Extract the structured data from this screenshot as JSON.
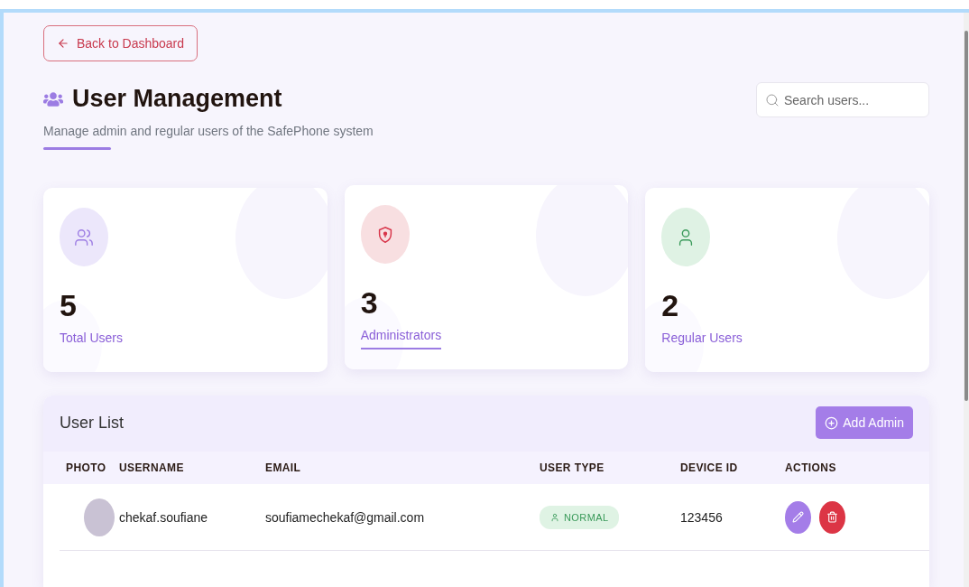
{
  "back_button": {
    "label": "Back to Dashboard"
  },
  "header": {
    "title": "User Management",
    "subtitle": "Manage admin and regular users of the SafePhone system"
  },
  "search": {
    "placeholder": "Search users..."
  },
  "stats": [
    {
      "kind": "total",
      "value": "5",
      "label": "Total Users",
      "selected": false
    },
    {
      "kind": "admin",
      "value": "3",
      "label": "Administrators",
      "selected": true
    },
    {
      "kind": "regular",
      "value": "2",
      "label": "Regular Users",
      "selected": false
    }
  ],
  "user_list": {
    "title": "User List",
    "add_button": "Add Admin",
    "columns": [
      "PHOTO",
      "USERNAME",
      "EMAIL",
      "USER TYPE",
      "DEVICE ID",
      "ACTIONS"
    ],
    "rows": [
      {
        "username": "chekaf.soufiane",
        "email": "soufiamechekaf@gmail.com",
        "user_type": {
          "kind": "normal",
          "label": "NORMAL"
        },
        "device_id": "123456"
      }
    ]
  }
}
